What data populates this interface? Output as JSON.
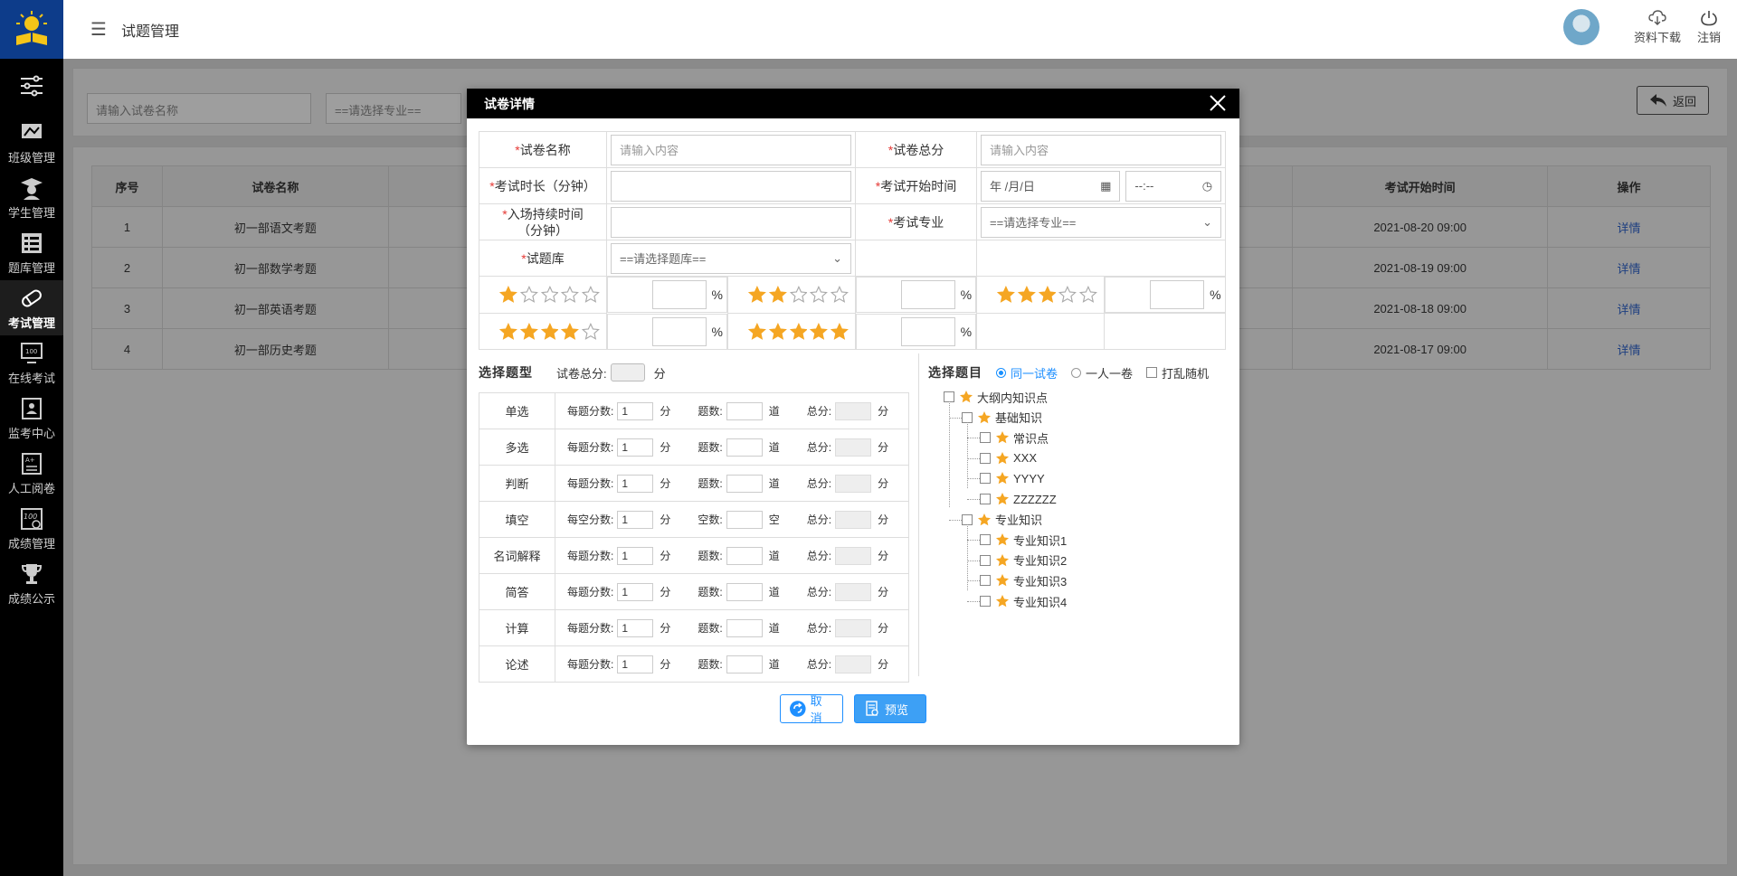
{
  "sidebar": {
    "items": [
      {
        "label": "班级管理",
        "icon": "class-icon"
      },
      {
        "label": "学生管理",
        "icon": "student-icon"
      },
      {
        "label": "题库管理",
        "icon": "question-bank-icon"
      },
      {
        "label": "考试管理",
        "icon": "exam-icon",
        "active": true
      },
      {
        "label": "在线考试",
        "icon": "online-exam-icon"
      },
      {
        "label": "监考中心",
        "icon": "proctor-icon"
      },
      {
        "label": "人工阅卷",
        "icon": "grading-icon"
      },
      {
        "label": "成绩管理",
        "icon": "score-icon"
      },
      {
        "label": "成绩公示",
        "icon": "trophy-icon"
      }
    ]
  },
  "header": {
    "title": "试题管理",
    "download_label": "资料下载",
    "logout_label": "注销"
  },
  "filter": {
    "name_placeholder": "请输入试卷名称",
    "major_select": "==请选择专业==",
    "back_label": "返回"
  },
  "table": {
    "headers": [
      "序号",
      "试卷名称",
      "考试开始时间",
      "操作"
    ],
    "rows": [
      {
        "no": "1",
        "name": "初一部语文考题",
        "start": "2021-08-20  09:00",
        "action": "详情"
      },
      {
        "no": "2",
        "name": "初一部数学考题",
        "start": "2021-08-19  09:00",
        "action": "详情"
      },
      {
        "no": "3",
        "name": "初一部英语考题",
        "start": "2021-08-18  09:00",
        "action": "详情"
      },
      {
        "no": "4",
        "name": "初一部历史考题",
        "start": "2021-08-17  09:00",
        "action": "详情"
      }
    ]
  },
  "modal": {
    "title": "试卷详情",
    "fields": {
      "paper_name": "试卷名称",
      "paper_name_ph": "请输入内容",
      "total_score": "试卷总分",
      "total_score_ph": "请输入内容",
      "duration": "考试时长（分钟）",
      "start_time": "考试开始时间",
      "date_ph": "年 /月/日",
      "time_ph": "--:--",
      "entry_duration_1": "入场持续时间",
      "entry_duration_2": "（分钟）",
      "major": "考试专业",
      "major_select": "==请选择专业==",
      "bank": "试题库",
      "bank_select": "==请选择题库=="
    },
    "difficulty": {
      "levels": [
        1,
        2,
        3,
        4,
        5
      ],
      "max": 5,
      "percent_sign": "%"
    },
    "types_section": {
      "title": "选择题型",
      "total_label": "试卷总分:",
      "unit_fen": "分",
      "rows": [
        {
          "name": "单选",
          "per_label": "每题分数:",
          "per_value": "1",
          "count_label": "题数:",
          "count_unit": "道",
          "sum_label": "总分:"
        },
        {
          "name": "多选",
          "per_label": "每题分数:",
          "per_value": "1",
          "count_label": "题数:",
          "count_unit": "道",
          "sum_label": "总分:"
        },
        {
          "name": "判断",
          "per_label": "每题分数:",
          "per_value": "1",
          "count_label": "题数:",
          "count_unit": "道",
          "sum_label": "总分:"
        },
        {
          "name": "填空",
          "per_label": "每空分数:",
          "per_value": "1",
          "count_label": "空数:",
          "count_unit": "空",
          "sum_label": "总分:"
        },
        {
          "name": "名词解释",
          "per_label": "每题分数:",
          "per_value": "1",
          "count_label": "题数:",
          "count_unit": "道",
          "sum_label": "总分:"
        },
        {
          "name": "简答",
          "per_label": "每题分数:",
          "per_value": "1",
          "count_label": "题数:",
          "count_unit": "道",
          "sum_label": "总分:"
        },
        {
          "name": "计算",
          "per_label": "每题分数:",
          "per_value": "1",
          "count_label": "题数:",
          "count_unit": "道",
          "sum_label": "总分:"
        },
        {
          "name": "论述",
          "per_label": "每题分数:",
          "per_value": "1",
          "count_label": "题数:",
          "count_unit": "道",
          "sum_label": "总分:"
        }
      ]
    },
    "topics_section": {
      "title": "选择题目",
      "opt_same": "同一试卷",
      "opt_each": "一人一卷",
      "opt_shuffle": "打乱随机",
      "tree": {
        "root": "大纲内知识点",
        "basic": "基础知识",
        "basic_children": [
          "常识点",
          "XXX",
          "YYYY",
          "ZZZZZZ"
        ],
        "major": "专业知识",
        "major_children": [
          "专业知识1",
          "专业知识2",
          "专业知识3",
          "专业知识4"
        ]
      }
    },
    "buttons": {
      "cancel": "取消",
      "preview": "预览"
    }
  },
  "colors": {
    "accent": "#1e8fff",
    "star": "#f5a623",
    "required": "#e53935"
  }
}
